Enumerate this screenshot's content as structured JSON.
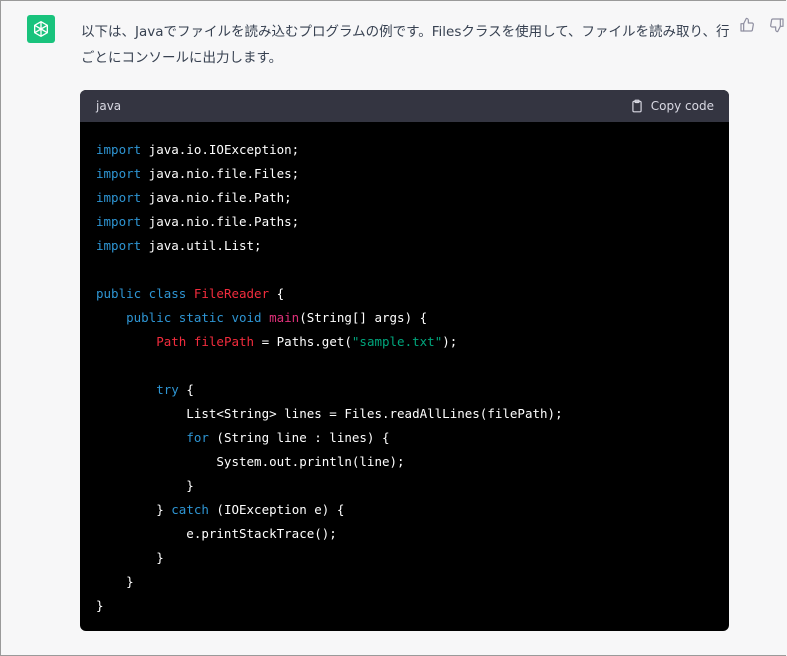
{
  "message": {
    "text": "以下は、Javaでファイルを読み込むプログラムの例です。Filesクラスを使用して、ファイルを読み取り、行ごとにコンソールに出力します。"
  },
  "code_block": {
    "language": "java",
    "copy_label": "Copy code"
  },
  "code_lines": [
    [
      {
        "t": "import",
        "c": "kw"
      },
      {
        "t": " java.io.IOException;"
      }
    ],
    [
      {
        "t": "import",
        "c": "kw"
      },
      {
        "t": " java.nio.file.Files;"
      }
    ],
    [
      {
        "t": "import",
        "c": "kw"
      },
      {
        "t": " java.nio.file.Path;"
      }
    ],
    [
      {
        "t": "import",
        "c": "kw"
      },
      {
        "t": " java.nio.file.Paths;"
      }
    ],
    [
      {
        "t": "import",
        "c": "kw"
      },
      {
        "t": " java.util.List;"
      }
    ],
    [],
    [
      {
        "t": "public class",
        "c": "kw"
      },
      {
        "t": " "
      },
      {
        "t": "FileReader",
        "c": "cls"
      },
      {
        "t": " {"
      }
    ],
    [
      {
        "t": "    "
      },
      {
        "t": "public static void",
        "c": "kw"
      },
      {
        "t": " "
      },
      {
        "t": "main",
        "c": "fn"
      },
      {
        "t": "(String[] args) {"
      }
    ],
    [
      {
        "t": "        "
      },
      {
        "t": "Path filePath",
        "c": "cls"
      },
      {
        "t": " = Paths.get("
      },
      {
        "t": "\"sample.txt\"",
        "c": "str"
      },
      {
        "t": ");"
      }
    ],
    [],
    [
      {
        "t": "        "
      },
      {
        "t": "try",
        "c": "kw"
      },
      {
        "t": " {"
      }
    ],
    [
      {
        "t": "            List<String> lines = Files.readAllLines(filePath);"
      }
    ],
    [
      {
        "t": "            "
      },
      {
        "t": "for",
        "c": "kw"
      },
      {
        "t": " (String line : lines) {"
      }
    ],
    [
      {
        "t": "                System.out.println(line);"
      }
    ],
    [
      {
        "t": "            }"
      }
    ],
    [
      {
        "t": "        } "
      },
      {
        "t": "catch",
        "c": "kw"
      },
      {
        "t": " (IOException e) {"
      }
    ],
    [
      {
        "t": "            e.printStackTrace();"
      }
    ],
    [
      {
        "t": "        }"
      }
    ],
    [
      {
        "t": "    }"
      }
    ],
    [
      {
        "t": "}"
      }
    ]
  ],
  "icons": {
    "avatar": "openai-logo-icon",
    "thumbs_up": "thumbs-up-icon",
    "thumbs_down": "thumbs-down-icon",
    "copy": "clipboard-icon"
  },
  "colors": {
    "avatar_bg": "#19c37d",
    "keyword": "#2e95d3",
    "class_name": "#f22c3d",
    "function": "#df3079",
    "string": "#00a67d",
    "code_bg": "#000000",
    "code_header_bg": "#343541"
  }
}
